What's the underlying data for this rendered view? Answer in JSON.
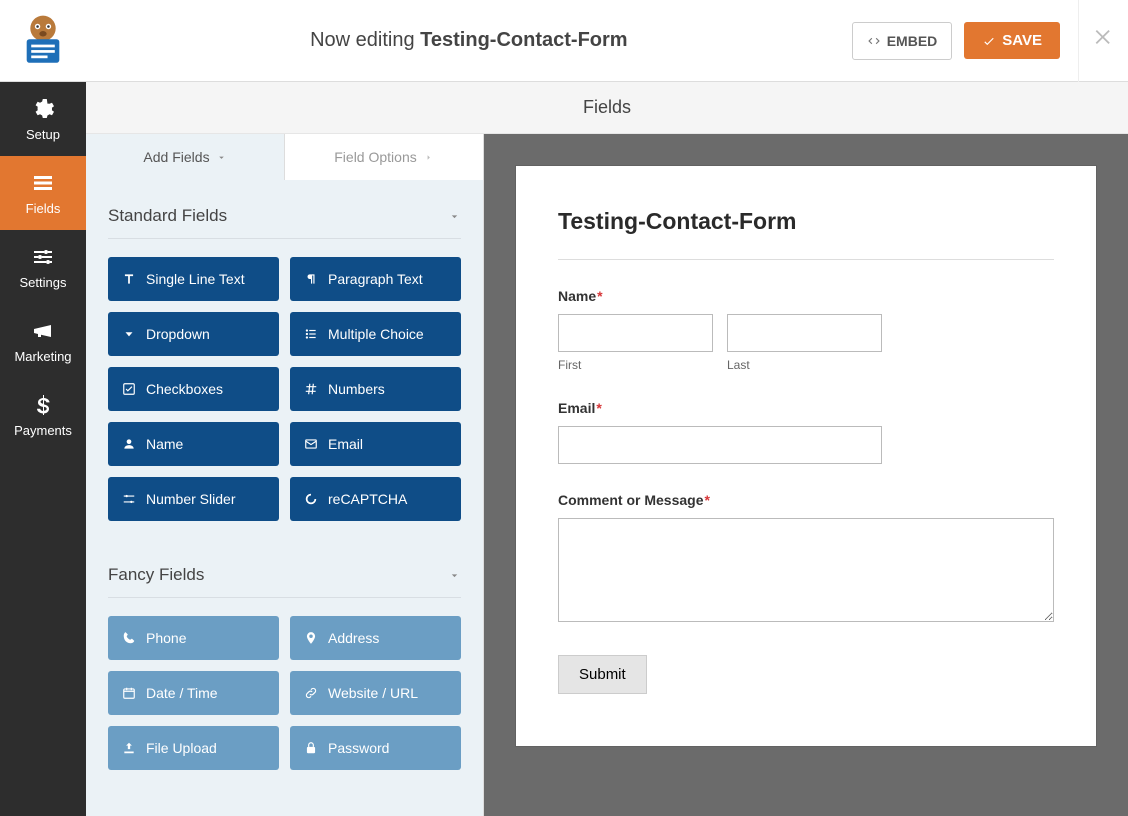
{
  "header": {
    "prefix": "Now editing ",
    "formname": "Testing-Contact-Form",
    "embed": "EMBED",
    "save": "SAVE"
  },
  "rail": {
    "setup": "Setup",
    "fields": "Fields",
    "settings": "Settings",
    "marketing": "Marketing",
    "payments": "Payments"
  },
  "secondary": {
    "title": "Fields"
  },
  "panel": {
    "tab_add": "Add Fields",
    "tab_options": "Field Options",
    "group_standard": "Standard Fields",
    "group_fancy": "Fancy Fields",
    "standard": {
      "single_line": "Single Line Text",
      "paragraph": "Paragraph Text",
      "dropdown": "Dropdown",
      "multiple_choice": "Multiple Choice",
      "checkboxes": "Checkboxes",
      "numbers": "Numbers",
      "name": "Name",
      "email": "Email",
      "number_slider": "Number Slider",
      "recaptcha": "reCAPTCHA"
    },
    "fancy": {
      "phone": "Phone",
      "address": "Address",
      "datetime": "Date / Time",
      "website": "Website / URL",
      "fileupload": "File Upload",
      "password": "Password"
    }
  },
  "preview": {
    "title": "Testing-Contact-Form",
    "name_label": "Name",
    "first": "First",
    "last": "Last",
    "email_label": "Email",
    "comment_label": "Comment or Message",
    "submit": "Submit"
  }
}
